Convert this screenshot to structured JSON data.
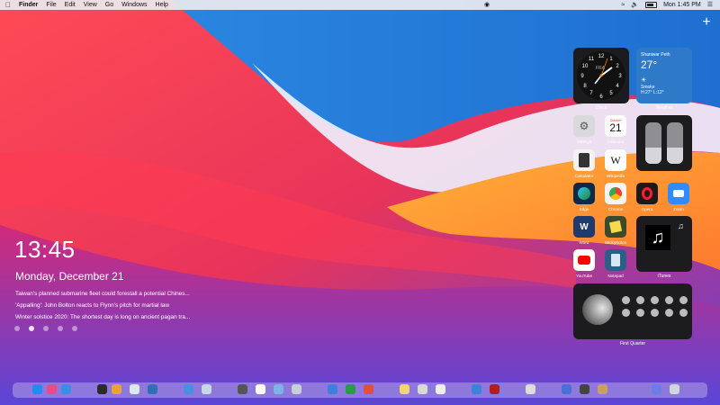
{
  "menubar": {
    "apple_icon": "apple-icon",
    "app_name": "Finder",
    "menus": [
      "File",
      "Edit",
      "View",
      "Go",
      "Windows",
      "Help"
    ],
    "clock": "Mon 1:45 PM"
  },
  "desktop": {
    "time": "13:45",
    "date": "Monday, December 21",
    "news": [
      "Taiwan's planned submarine fleet could forestall a potential Chines...",
      "'Appalling': John Bolton reacts to Flynn's pitch for martial law",
      "Winter solstice 2020: The shortest day is long on ancient pagan tra..."
    ],
    "page_count": 5,
    "active_page": 2
  },
  "widgets": {
    "clock": {
      "label": "Clock",
      "sub": "FRA"
    },
    "weather": {
      "label": "Weather",
      "location": "Shaniwar Peth",
      "temp": "27°",
      "condition": "Smoke",
      "range": "H:27° L:12°"
    },
    "calendar": {
      "month": "October",
      "day": "21"
    },
    "music": {
      "label": "iTunes"
    },
    "moon": {
      "label": "First Quarter"
    }
  },
  "apps": [
    {
      "id": "settings",
      "label": "Settings"
    },
    {
      "id": "calendar",
      "label": "Calendar"
    },
    {
      "id": "calculator",
      "label": "Calculator"
    },
    {
      "id": "wikipedia",
      "label": "Wikipedia",
      "glyph": "W"
    },
    {
      "id": "edge",
      "label": "Edge"
    },
    {
      "id": "chrome",
      "label": "Chrome"
    },
    {
      "id": "opera",
      "label": "Opera"
    },
    {
      "id": "zoom",
      "label": "Zoom"
    },
    {
      "id": "word",
      "label": "Word",
      "glyph": "W"
    },
    {
      "id": "stickynotes",
      "label": "StickyNotes"
    },
    {
      "id": "youtube",
      "label": "YouTube"
    },
    {
      "id": "notepad",
      "label": "Notepad"
    }
  ],
  "colors": {
    "menubar": "#ebebf0",
    "weather": "#2f79c9",
    "widget": "#1c1c1e"
  }
}
